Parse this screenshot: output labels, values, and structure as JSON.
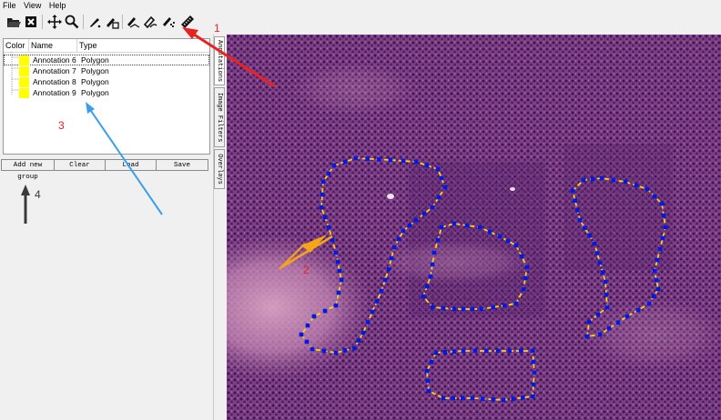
{
  "menu": [
    "File",
    "View",
    "Help"
  ],
  "toolbar": {
    "icons": [
      "open-icon",
      "close-icon",
      "move-icon",
      "zoom-icon",
      "point-annotation-icon",
      "freehand-annotation-icon",
      "polygon-annotation-icon",
      "eraser-icon",
      "spline-annotation-icon",
      "ruler-icon"
    ]
  },
  "annotations_panel": {
    "columns": [
      "Color",
      "Name",
      "Type"
    ],
    "rows": [
      {
        "name": "Annotation 6",
        "type": "Polygon",
        "color": "#ffff00"
      },
      {
        "name": "Annotation 7",
        "type": "Polygon",
        "color": "#ffff00"
      },
      {
        "name": "Annotation 8",
        "type": "Polygon",
        "color": "#ffff00"
      },
      {
        "name": "Annotation 9",
        "type": "Polygon",
        "color": "#ffff00"
      }
    ],
    "buttons": [
      "Add new group",
      "Clear",
      "Load",
      "Save"
    ]
  },
  "side_tabs": [
    "Annotations",
    "Image Filters",
    "Overlays"
  ],
  "callouts": {
    "n1": "1",
    "n2": "2",
    "n3": "3",
    "n4": "4"
  },
  "colors": {
    "annotation_line": "#ffd21a",
    "annotation_vertex": "#0019e6",
    "arrow_red": "#e8231f",
    "arrow_blue": "#3aa0ee",
    "arrow_orange": "#f4a51a",
    "arrow_dark": "#3a3a3a",
    "tissue": "#8a4a86"
  }
}
